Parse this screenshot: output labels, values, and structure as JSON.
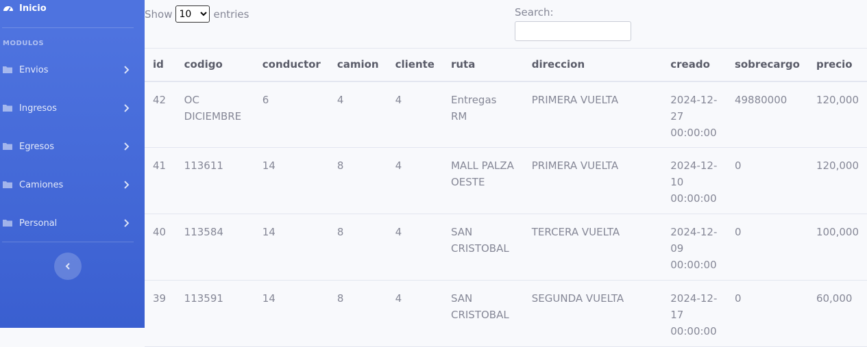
{
  "sidebar": {
    "home_label": "Inicio",
    "home_icon": "tachometer-icon",
    "heading": "MODULOS",
    "items": [
      {
        "label": "Envios"
      },
      {
        "label": "Ingresos"
      },
      {
        "label": "Egresos"
      },
      {
        "label": "Camiones"
      },
      {
        "label": "Personal"
      }
    ],
    "toggle_icon": "chevron-left-icon"
  },
  "controls": {
    "show_label": "Show",
    "entries_label": "entries",
    "page_length": "10",
    "search_label": "Search:",
    "search_value": ""
  },
  "table": {
    "columns": [
      "id",
      "codigo",
      "conductor",
      "camion",
      "cliente",
      "ruta",
      "direccion",
      "creado",
      "sobrecargo",
      "precio"
    ],
    "rows": [
      [
        "42",
        "OC DICIEMBRE",
        "6",
        "4",
        "4",
        "Entregas RM",
        "PRIMERA VUELTA",
        "2024-12-27 00:00:00",
        "49880000",
        "120,000"
      ],
      [
        "41",
        "113611",
        "14",
        "8",
        "4",
        "MALL PALZA OESTE",
        "PRIMERA VUELTA",
        "2024-12-10 00:00:00",
        "0",
        "120,000"
      ],
      [
        "40",
        "113584",
        "14",
        "8",
        "4",
        "SAN CRISTOBAL",
        "TERCERA VUELTA",
        "2024-12-09 00:00:00",
        "0",
        "100,000"
      ],
      [
        "39",
        "113591",
        "14",
        "8",
        "4",
        "SAN CRISTOBAL",
        "SEGUNDA VUELTA",
        "2024-12-17 00:00:00",
        "0",
        "60,000"
      ]
    ]
  },
  "colors": {
    "sidebar": "#4e73df",
    "text": "#858796",
    "heading_text": "#5a5c69"
  }
}
